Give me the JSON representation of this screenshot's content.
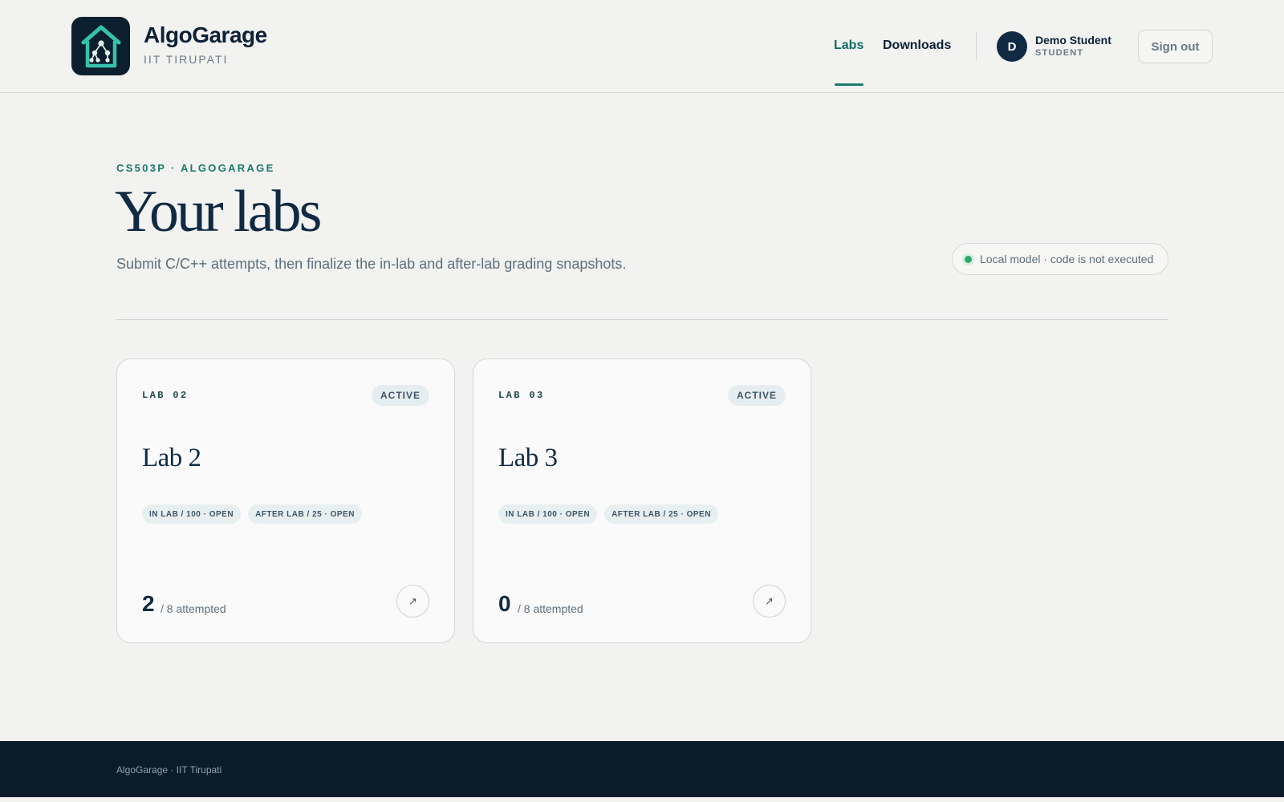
{
  "brand": {
    "name": "AlgoGarage",
    "subtitle": "IIT TIRUPATI",
    "logo_icon": "house-tree-icon"
  },
  "nav": {
    "labs_label": "Labs",
    "downloads_label": "Downloads",
    "active": "Labs"
  },
  "user": {
    "initial": "D",
    "name": "Demo Student",
    "role": "STUDENT"
  },
  "signout_label": "Sign out",
  "main": {
    "eyebrow": "CS503P · ALGOGARAGE",
    "title": "Your labs",
    "description": "Submit C/C++ attempts, then finalize the in-lab and after-lab grading snapshots.",
    "status": "Local model · code is not executed"
  },
  "labs": [
    {
      "tag": "LAB 02",
      "badge": "ACTIVE",
      "title": "Lab 2",
      "chips": [
        "IN LAB / 100 · OPEN",
        "AFTER LAB / 25 · OPEN"
      ],
      "attempted": "2",
      "attempted_suffix": "/ 8 attempted"
    },
    {
      "tag": "LAB 03",
      "badge": "ACTIVE",
      "title": "Lab 3",
      "chips": [
        "IN LAB / 100 · OPEN",
        "AFTER LAB / 25 · OPEN"
      ],
      "attempted": "0",
      "attempted_suffix": "/ 8 attempted"
    }
  ],
  "footer": {
    "text": "AlgoGarage · IIT Tirupati"
  },
  "colors": {
    "accent": "#1a7a6c",
    "navy": "#102a43",
    "footer_bg": "#0c1b2a",
    "status_green": "#2fa866"
  }
}
